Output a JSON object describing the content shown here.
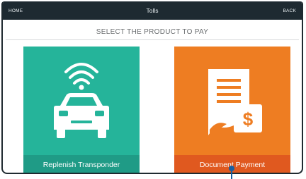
{
  "topbar": {
    "home_label": "HOME",
    "title": "Tolls",
    "back_label": "BACK",
    "background": "#1e2a31"
  },
  "prompt": "SELECT THE PRODUCT TO PAY",
  "tiles": [
    {
      "label": "Replenish Transponder",
      "color": "#25b49a",
      "icon": "car-transponder-icon"
    },
    {
      "label": "Document Payment",
      "color": "#ee7d22",
      "icon": "document-payment-icon"
    }
  ]
}
